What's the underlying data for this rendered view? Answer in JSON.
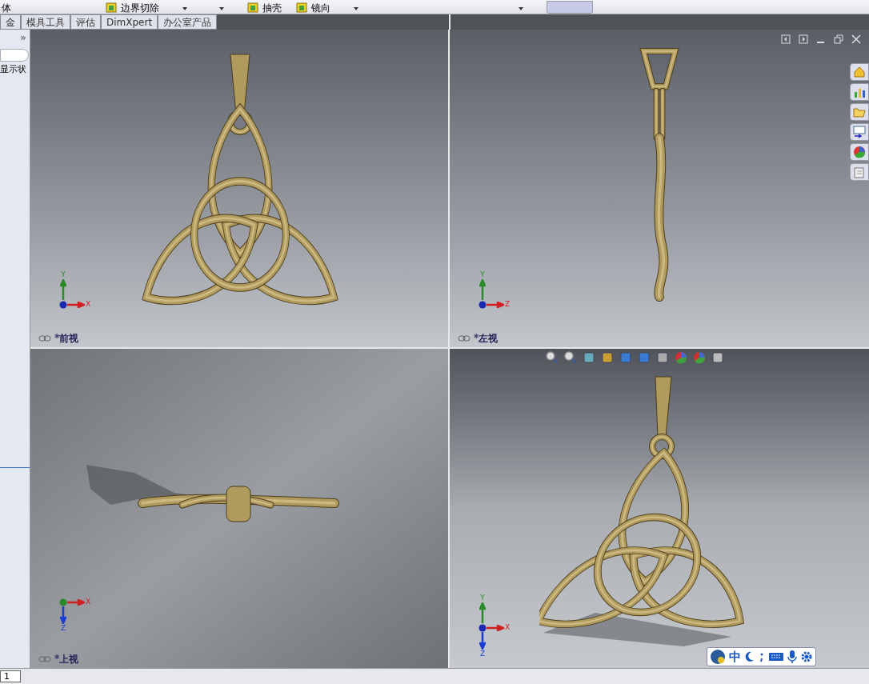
{
  "toolbar": {
    "items": [
      {
        "kind": "text",
        "label": "体"
      },
      {
        "kind": "tool",
        "label": "边界切除"
      },
      {
        "kind": "dropdown"
      },
      {
        "kind": "dropdown"
      },
      {
        "kind": "tool",
        "label": "抽壳"
      },
      {
        "kind": "tool",
        "label": "镜向"
      },
      {
        "kind": "dropdown"
      },
      {
        "kind": "dropdown"
      }
    ]
  },
  "tabs": [
    {
      "label": "金",
      "selected": false
    },
    {
      "label": "模具工具",
      "selected": false
    },
    {
      "label": "评估",
      "selected": false
    },
    {
      "label": "DimXpert",
      "selected": false
    },
    {
      "label": "办公室产品",
      "selected": false
    }
  ],
  "left_panel": {
    "expand": "»",
    "label": "显示状"
  },
  "viewports": [
    {
      "kind": "front",
      "label": "*前视",
      "axes": [
        {
          "kind": "up",
          "label": "Y"
        },
        {
          "kind": "right",
          "label": "X"
        }
      ]
    },
    {
      "kind": "left",
      "label": "*左视",
      "axes": [
        {
          "kind": "up",
          "label": "Y"
        },
        {
          "kind": "right",
          "label": "Z"
        }
      ]
    },
    {
      "kind": "top",
      "label": "*上视",
      "axes": [
        {
          "kind": "right",
          "label": "X"
        },
        {
          "kind": "down",
          "label": "Z"
        }
      ]
    },
    {
      "kind": "iso",
      "axes": [
        {
          "kind": "up",
          "label": "Y"
        },
        {
          "kind": "right",
          "label": "X"
        },
        {
          "kind": "down",
          "label": "Z"
        }
      ]
    }
  ],
  "ime_bar": {
    "mode": "中"
  },
  "status_bar": {
    "sheet_tab": "1"
  }
}
